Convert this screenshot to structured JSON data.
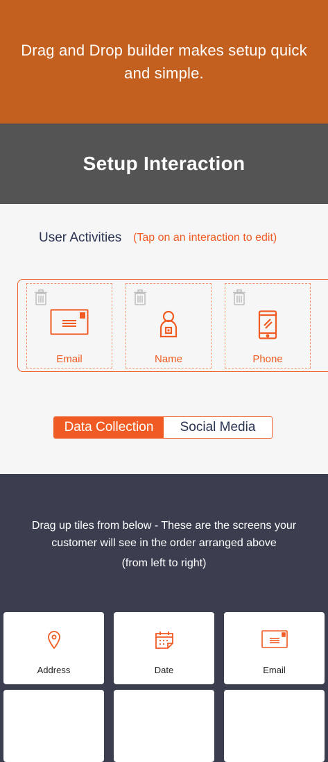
{
  "banner": {
    "text": "Drag and Drop builder makes setup quick and simple."
  },
  "header": {
    "title": "Setup Interaction"
  },
  "activities": {
    "heading": "User Activities",
    "hint": "(Tap on an interaction to edit)",
    "slots": [
      {
        "label": "Email",
        "icon": "envelope-icon"
      },
      {
        "label": "Name",
        "icon": "person-icon"
      },
      {
        "label": "Phone",
        "icon": "phone-icon"
      }
    ]
  },
  "toggle": {
    "active": "Data Collection",
    "inactive": "Social Media"
  },
  "instructions": {
    "line1": "Drag up tiles from below - These are the screens your",
    "line2": "customer  will see in the order arranged above",
    "line3": "(from left to right)"
  },
  "tiles": [
    {
      "label": "Address",
      "icon": "location-pin-icon"
    },
    {
      "label": "Date",
      "icon": "calendar-icon"
    },
    {
      "label": "Email",
      "icon": "envelope-icon"
    },
    {
      "label": "",
      "icon": ""
    },
    {
      "label": "",
      "icon": ""
    },
    {
      "label": "",
      "icon": ""
    }
  ],
  "colors": {
    "banner": "#c4601f",
    "header": "#545454",
    "accent": "#f05a23",
    "dark_bg": "#3b3e4f",
    "light_bg": "#f6f6f6"
  }
}
